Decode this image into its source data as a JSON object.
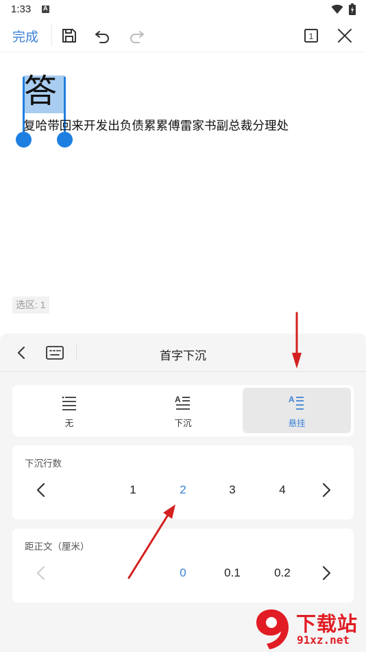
{
  "status_bar": {
    "time": "1:33"
  },
  "toolbar": {
    "done_label": "完成"
  },
  "document": {
    "first_char": "答",
    "body_text": "复哈带回来开发出负债累累傅雷家书副总裁分理处",
    "selection_count": "选区: 1"
  },
  "panel": {
    "title": "首字下沉",
    "modes": [
      {
        "label": "无",
        "icon": "no-dropcap-icon",
        "active": false
      },
      {
        "label": "下沉",
        "icon": "dropcap-icon",
        "active": false
      },
      {
        "label": "悬挂",
        "icon": "hanging-dropcap-icon",
        "active": true
      }
    ],
    "lines": {
      "label": "下沉行数",
      "values": [
        "1",
        "2",
        "3",
        "4"
      ],
      "selected": "2"
    },
    "offset": {
      "label": "距正文（厘米）",
      "values": [
        "0",
        "0.1",
        "0.2"
      ],
      "selected": "0"
    }
  },
  "watermark": {
    "text": "下载站",
    "url": "91xz.net",
    "logo_text": "91"
  },
  "colors": {
    "accent": "#3b82d8",
    "selection": "#1f7fe0",
    "arrow": "#d42020",
    "watermark": "#e11c24"
  }
}
